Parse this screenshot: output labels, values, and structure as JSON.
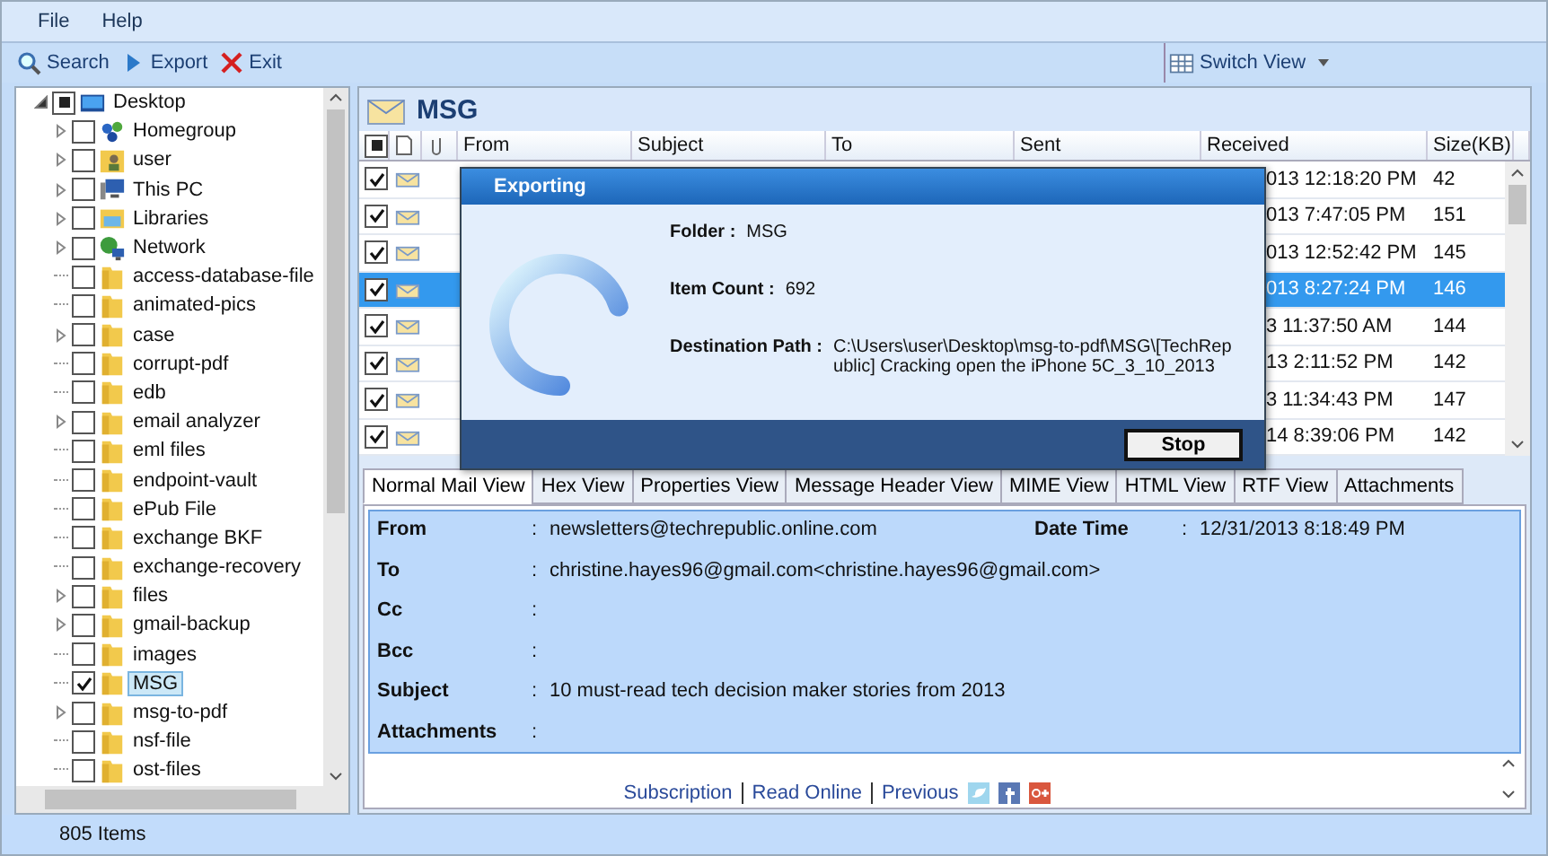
{
  "menu": [
    "File",
    "Help"
  ],
  "toolbar": [
    {
      "label": "Search",
      "kind": "search"
    },
    {
      "label": "Export",
      "kind": "export"
    },
    {
      "label": "Exit",
      "kind": "exit"
    }
  ],
  "switch_view": {
    "label": "Switch View"
  },
  "tree": {
    "label": "Desktop",
    "expanded": true,
    "indeterminate": true,
    "kind": "desktop",
    "children": [
      {
        "label": "Homegroup",
        "kind": "homegroup",
        "expandable": true,
        "checked": false,
        "selected": false
      },
      {
        "label": "user",
        "kind": "user",
        "expandable": true,
        "checked": false,
        "selected": false
      },
      {
        "label": "This PC",
        "kind": "pc",
        "expandable": true,
        "checked": false,
        "selected": false
      },
      {
        "label": "Libraries",
        "kind": "libraries",
        "expandable": true,
        "checked": false,
        "selected": false
      },
      {
        "label": "Network",
        "kind": "network",
        "expandable": true,
        "checked": false,
        "selected": false
      },
      {
        "label": "access-database-file",
        "kind": "folder",
        "expandable": false,
        "checked": false,
        "selected": false
      },
      {
        "label": "animated-pics",
        "kind": "folder",
        "expandable": false,
        "checked": false,
        "selected": false
      },
      {
        "label": "case",
        "kind": "folder",
        "expandable": true,
        "checked": false,
        "selected": false
      },
      {
        "label": "corrupt-pdf",
        "kind": "folder",
        "expandable": false,
        "checked": false,
        "selected": false
      },
      {
        "label": "edb",
        "kind": "folder",
        "expandable": false,
        "checked": false,
        "selected": false
      },
      {
        "label": "email analyzer",
        "kind": "folder",
        "expandable": true,
        "checked": false,
        "selected": false
      },
      {
        "label": "eml files",
        "kind": "folder",
        "expandable": false,
        "checked": false,
        "selected": false
      },
      {
        "label": "endpoint-vault",
        "kind": "folder",
        "expandable": false,
        "checked": false,
        "selected": false
      },
      {
        "label": "ePub File",
        "kind": "folder",
        "expandable": false,
        "checked": false,
        "selected": false
      },
      {
        "label": "exchange BKF",
        "kind": "folder",
        "expandable": false,
        "checked": false,
        "selected": false
      },
      {
        "label": "exchange-recovery",
        "kind": "folder",
        "expandable": false,
        "checked": false,
        "selected": false
      },
      {
        "label": "files",
        "kind": "folder",
        "expandable": true,
        "checked": false,
        "selected": false
      },
      {
        "label": "gmail-backup",
        "kind": "folder",
        "expandable": true,
        "checked": false,
        "selected": false
      },
      {
        "label": "images",
        "kind": "folder",
        "expandable": false,
        "checked": false,
        "selected": false
      },
      {
        "label": "MSG",
        "kind": "folder",
        "expandable": false,
        "checked": true,
        "selected": true
      },
      {
        "label": "msg-to-pdf",
        "kind": "folder",
        "expandable": true,
        "checked": false,
        "selected": false
      },
      {
        "label": "nsf-file",
        "kind": "folder",
        "expandable": false,
        "checked": false,
        "selected": false
      },
      {
        "label": "ost-files",
        "kind": "folder",
        "expandable": false,
        "checked": false,
        "selected": false
      }
    ]
  },
  "status_bar": "805 Items",
  "folder_title": "MSG",
  "table": {
    "header_checkbox": {
      "indeterminate": true
    },
    "columns": [
      "From",
      "Subject",
      "To",
      "Sent",
      "Received",
      "Size(KB)"
    ],
    "rows": [
      {
        "checked": true,
        "selected": false,
        "received": "013 12:18:20 PM",
        "size": "42"
      },
      {
        "checked": true,
        "selected": false,
        "received": "013 7:47:05 PM",
        "size": "151"
      },
      {
        "checked": true,
        "selected": false,
        "received": "013 12:52:42 PM",
        "size": "145"
      },
      {
        "checked": true,
        "selected": true,
        "received": "013 8:27:24 PM",
        "size": "146"
      },
      {
        "checked": true,
        "selected": false,
        "received": "3 11:37:50 AM",
        "size": "144"
      },
      {
        "checked": true,
        "selected": false,
        "received": "13 2:11:52 PM",
        "size": "142"
      },
      {
        "checked": true,
        "selected": false,
        "received": "3 11:34:43 PM",
        "size": "147"
      },
      {
        "checked": true,
        "selected": false,
        "received": "14 8:39:06 PM",
        "size": "142"
      }
    ]
  },
  "dialog": {
    "title": "Exporting",
    "level": 0.7,
    "fields": [
      {
        "label": "Folder :",
        "value": "MSG"
      },
      {
        "label": "Item Count :",
        "value": "692"
      },
      {
        "label": "Destination Path :",
        "value": "C:\\Users\\user\\Desktop\\msg-to-pdf\\MSG\\[TechRepublic] Cracking open the iPhone 5C_3_10_2013"
      }
    ],
    "button": "Stop"
  },
  "tabs": [
    {
      "label": "Normal Mail View",
      "selected": true
    },
    {
      "label": "Hex View",
      "selected": false
    },
    {
      "label": "Properties View",
      "selected": false
    },
    {
      "label": "Message Header View",
      "selected": false
    },
    {
      "label": "MIME View",
      "selected": false
    },
    {
      "label": "HTML View",
      "selected": false
    },
    {
      "label": "RTF View",
      "selected": false
    },
    {
      "label": "Attachments",
      "selected": false
    }
  ],
  "mail": {
    "from": {
      "label": "From",
      "sep": ":",
      "value": "newsletters@techrepublic.online.com"
    },
    "date_time": {
      "label": "Date Time",
      "sep": ":",
      "value": "12/31/2013 8:18:49 PM"
    },
    "fields": [
      {
        "label": "To",
        "sep": ":",
        "value": "christine.hayes96@gmail.com<christine.hayes96@gmail.com>"
      },
      {
        "label": "Cc",
        "sep": ":"
      },
      {
        "label": "Bcc",
        "sep": ":"
      },
      {
        "label": "Subject",
        "sep": ":",
        "value": "10 must-read tech decision maker stories from 2013"
      },
      {
        "label": "Attachments",
        "sep": ":"
      }
    ],
    "links": [
      "Subscription",
      "Read Online",
      "Previous"
    ]
  }
}
